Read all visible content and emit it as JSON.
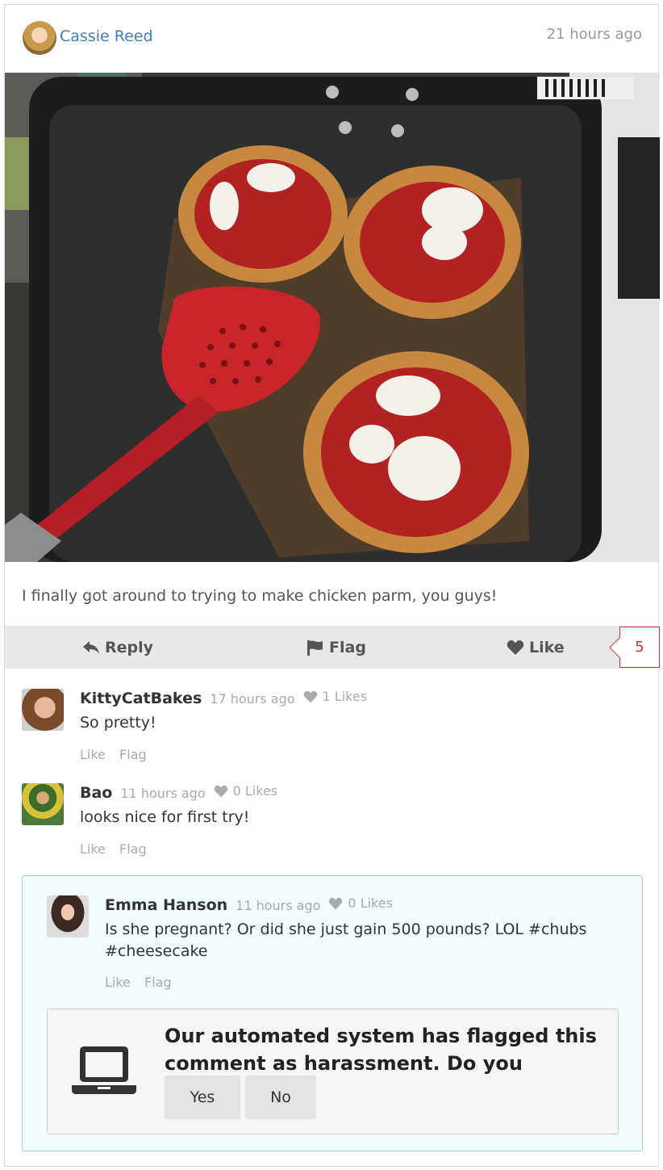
{
  "post": {
    "author": "Cassie Reed",
    "time": "21 hours ago",
    "caption": "I finally got around to trying to make chicken parm, you guys!",
    "photo_icon": "food-photo"
  },
  "actions": {
    "reply_label": "Reply",
    "flag_label": "Flag",
    "like_label": "Like",
    "like_count": "5"
  },
  "comments": [
    {
      "name": "KittyCatBakes",
      "time": "17 hours ago",
      "likes": "1 Likes",
      "text": "So pretty!",
      "like_label": "Like",
      "flag_label": "Flag"
    },
    {
      "name": "Bao",
      "time": "11 hours ago",
      "likes": "0 Likes",
      "text": "looks nice for first try!",
      "like_label": "Like",
      "flag_label": "Flag"
    },
    {
      "name": "Emma Hanson",
      "time": "11 hours ago",
      "likes": "0 Likes",
      "text": "Is she pregnant? Or did she just gain 500 pounds? LOL #chubs #cheesecake",
      "like_label": "Like",
      "flag_label": "Flag"
    }
  ],
  "moderation": {
    "question": "Our automated system has flagged this comment as harassment. Do you agree?",
    "yes_label": "Yes",
    "no_label": "No",
    "icon": "laptop-icon"
  },
  "colors": {
    "link": "#3f7fbf",
    "flag_accent": "#cc3333",
    "flag_box_border": "#9fd3df",
    "flag_box_bg": "#f2fcfe"
  }
}
